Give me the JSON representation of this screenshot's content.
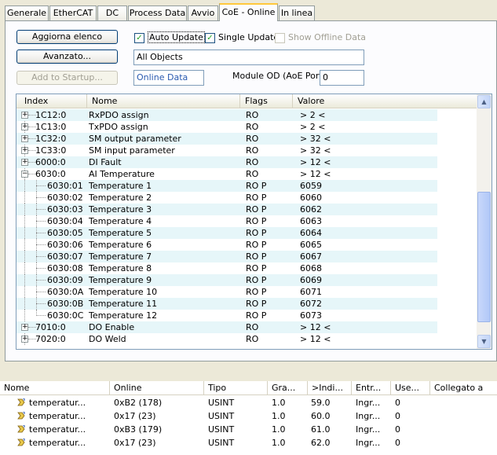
{
  "tabs": [
    "Generale",
    "EtherCAT",
    "DC",
    "Process Data",
    "Avvio",
    "CoE - Online",
    "In linea"
  ],
  "buttons": {
    "aggiorna": "Aggiorna elenco",
    "avanzato": "Avanzato...",
    "add_startup": "Add to Startup..."
  },
  "checks": {
    "auto_update": "Auto Update",
    "single_update": "Single Update",
    "show_offline": "Show Offline Data"
  },
  "filter_value": "All Objects",
  "mode_value": "Online Data",
  "module_od_label": "Module OD (AoE Port):",
  "module_od_value": "0",
  "list_headers": [
    "Index",
    "Nome",
    "Flags",
    "Valore"
  ],
  "rows": [
    {
      "index": "1C12:0",
      "name": "RxPDO assign",
      "flags": "RO",
      "value": "> 2 <",
      "exp": "+",
      "level": 0
    },
    {
      "index": "1C13:0",
      "name": "TxPDO assign",
      "flags": "RO",
      "value": "> 2 <",
      "exp": "+",
      "level": 0
    },
    {
      "index": "1C32:0",
      "name": "SM output parameter",
      "flags": "RO",
      "value": "> 32 <",
      "exp": "+",
      "level": 0
    },
    {
      "index": "1C33:0",
      "name": "SM input parameter",
      "flags": "RO",
      "value": "> 32 <",
      "exp": "+",
      "level": 0
    },
    {
      "index": "6000:0",
      "name": "DI Fault",
      "flags": "RO",
      "value": "> 12 <",
      "exp": "+",
      "level": 0
    },
    {
      "index": "6030:0",
      "name": "AI Temperature",
      "flags": "RO",
      "value": "> 12 <",
      "exp": "-",
      "level": 0
    },
    {
      "index": "6030:01",
      "name": "Temperature 1",
      "flags": "RO P",
      "value": "6059",
      "level": 1
    },
    {
      "index": "6030:02",
      "name": "Temperature 2",
      "flags": "RO P",
      "value": "6060",
      "level": 1
    },
    {
      "index": "6030:03",
      "name": "Temperature 3",
      "flags": "RO P",
      "value": "6062",
      "level": 1
    },
    {
      "index": "6030:04",
      "name": "Temperature 4",
      "flags": "RO P",
      "value": "6063",
      "level": 1
    },
    {
      "index": "6030:05",
      "name": "Temperature 5",
      "flags": "RO P",
      "value": "6064",
      "level": 1
    },
    {
      "index": "6030:06",
      "name": "Temperature 6",
      "flags": "RO P",
      "value": "6065",
      "level": 1
    },
    {
      "index": "6030:07",
      "name": "Temperature 7",
      "flags": "RO P",
      "value": "6067",
      "level": 1
    },
    {
      "index": "6030:08",
      "name": "Temperature 8",
      "flags": "RO P",
      "value": "6068",
      "level": 1
    },
    {
      "index": "6030:09",
      "name": "Temperature 9",
      "flags": "RO P",
      "value": "6069",
      "level": 1
    },
    {
      "index": "6030:0A",
      "name": "Temperature 10",
      "flags": "RO P",
      "value": "6071",
      "level": 1
    },
    {
      "index": "6030:0B",
      "name": "Temperature 11",
      "flags": "RO P",
      "value": "6072",
      "level": 1
    },
    {
      "index": "6030:0C",
      "name": "Temperature 12",
      "flags": "RO P",
      "value": "6073",
      "level": 1
    },
    {
      "index": "7010:0",
      "name": "DO Enable",
      "flags": "RO",
      "value": "> 12 <",
      "exp": "+",
      "level": 0
    },
    {
      "index": "7020:0",
      "name": "DO Weld",
      "flags": "RO",
      "value": "> 12 <",
      "exp": "+",
      "level": 0
    }
  ],
  "var_headers": [
    "Nome",
    "Online",
    "Tipo",
    "Gra...",
    ">Indi...",
    "Entr...",
    "Use...",
    "Collegato a"
  ],
  "var_rows": [
    {
      "name": "temperatur...",
      "online": "0xB2 (178)",
      "tipo": "USINT",
      "gra": "1.0",
      "indi": "59.0",
      "entr": "Ingr...",
      "use": "0"
    },
    {
      "name": "temperatur...",
      "online": "0x17 (23)",
      "tipo": "USINT",
      "gra": "1.0",
      "indi": "60.0",
      "entr": "Ingr...",
      "use": "0"
    },
    {
      "name": "temperatur...",
      "online": "0xB3 (179)",
      "tipo": "USINT",
      "gra": "1.0",
      "indi": "61.0",
      "entr": "Ingr...",
      "use": "0"
    },
    {
      "name": "temperatur...",
      "online": "0x17 (23)",
      "tipo": "USINT",
      "gra": "1.0",
      "indi": "62.0",
      "entr": "Ingr...",
      "use": "0"
    }
  ]
}
